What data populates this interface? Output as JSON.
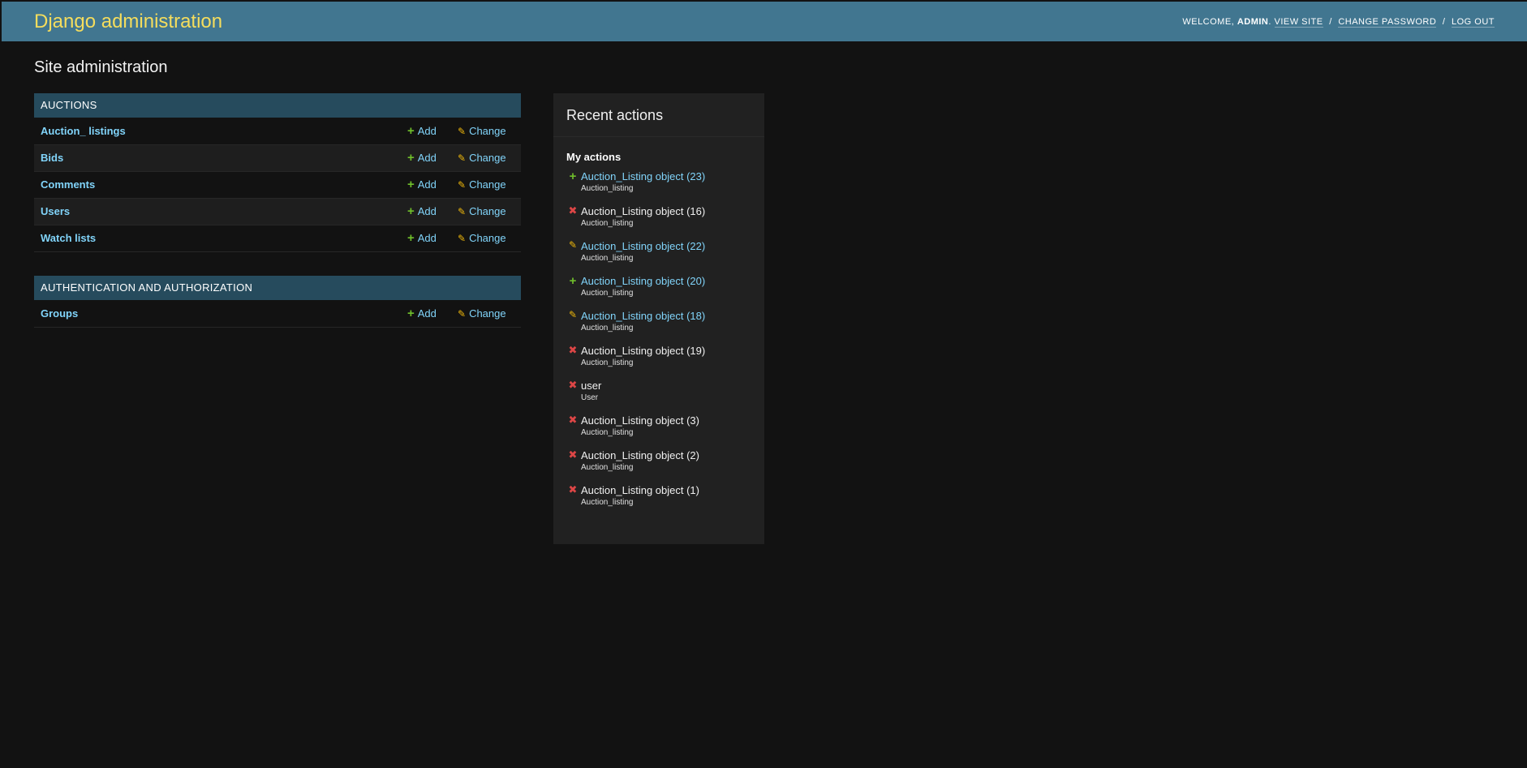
{
  "header": {
    "title": "Django administration",
    "welcome": "Welcome,",
    "username": "admin",
    "view_site": "View site",
    "change_password": "Change password",
    "log_out": "Log out",
    "separator": "/"
  },
  "page_title": "Site administration",
  "apps": [
    {
      "name": "Auctions",
      "models": [
        {
          "name": "Auction_ listings",
          "add": "Add",
          "change": "Change"
        },
        {
          "name": "Bids",
          "add": "Add",
          "change": "Change"
        },
        {
          "name": "Comments",
          "add": "Add",
          "change": "Change"
        },
        {
          "name": "Users",
          "add": "Add",
          "change": "Change"
        },
        {
          "name": "Watch lists",
          "add": "Add",
          "change": "Change"
        }
      ]
    },
    {
      "name": "Authentication and Authorization",
      "models": [
        {
          "name": "Groups",
          "add": "Add",
          "change": "Change"
        }
      ]
    }
  ],
  "recent_actions": {
    "title": "Recent actions",
    "subtitle": "My actions",
    "items": [
      {
        "icon": "add-icon",
        "label": "Auction_Listing object (23)",
        "type": "Auction_listing",
        "link": true
      },
      {
        "icon": "delete-icon",
        "label": "Auction_Listing object (16)",
        "type": "Auction_listing",
        "link": false
      },
      {
        "icon": "change-icon",
        "label": "Auction_Listing object (22)",
        "type": "Auction_listing",
        "link": true
      },
      {
        "icon": "add-icon",
        "label": "Auction_Listing object (20)",
        "type": "Auction_listing",
        "link": true
      },
      {
        "icon": "change-icon",
        "label": "Auction_Listing object (18)",
        "type": "Auction_listing",
        "link": true
      },
      {
        "icon": "delete-icon",
        "label": "Auction_Listing object (19)",
        "type": "Auction_listing",
        "link": false
      },
      {
        "icon": "delete-icon",
        "label": "user",
        "type": "User",
        "link": false
      },
      {
        "icon": "delete-icon",
        "label": "Auction_Listing object (3)",
        "type": "Auction_listing",
        "link": false
      },
      {
        "icon": "delete-icon",
        "label": "Auction_Listing object (2)",
        "type": "Auction_listing",
        "link": false
      },
      {
        "icon": "delete-icon",
        "label": "Auction_Listing object (1)",
        "type": "Auction_listing",
        "link": false
      }
    ]
  },
  "colors": {
    "header_bg": "#417690",
    "brand": "#f5dd5d",
    "caption_bg": "#264b5d",
    "link": "#81d4fa",
    "add": "#70bf2b",
    "change": "#efb80b",
    "delete": "#dd4646"
  }
}
